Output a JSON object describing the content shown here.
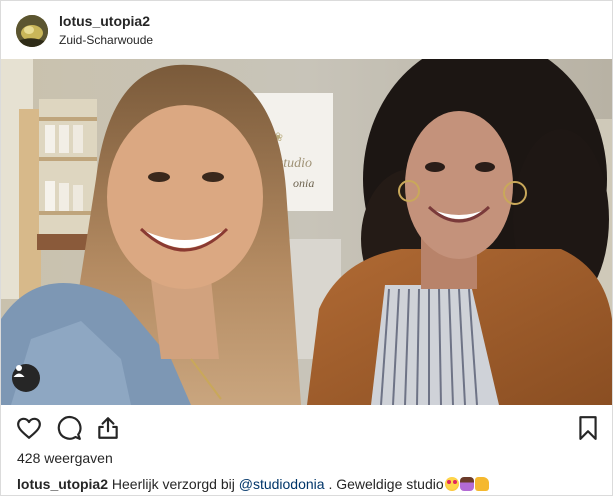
{
  "header": {
    "username": "lotus_utopia2",
    "location": "Zuid-Scharwoude"
  },
  "stats": {
    "views": "428 weergaven"
  },
  "caption": {
    "username": "lotus_utopia2",
    "text_before": "Heerlijk verzorgd bij",
    "mention": "@studiodonia",
    "text_after": ". Geweldige studio",
    "emojis": [
      "heart-eyes-face",
      "person-raising-hand",
      "thumbs-up"
    ]
  },
  "media_sign": {
    "line1": " studio",
    "line2": "onia"
  },
  "icons": {
    "avatar": "user-avatar",
    "tag": "person-icon",
    "like": "heart-icon",
    "comment": "comment-icon",
    "share": "share-icon",
    "save": "bookmark-icon"
  },
  "colors": {
    "text": "#262626",
    "mention": "#003569",
    "border": "#dbdbdb"
  }
}
